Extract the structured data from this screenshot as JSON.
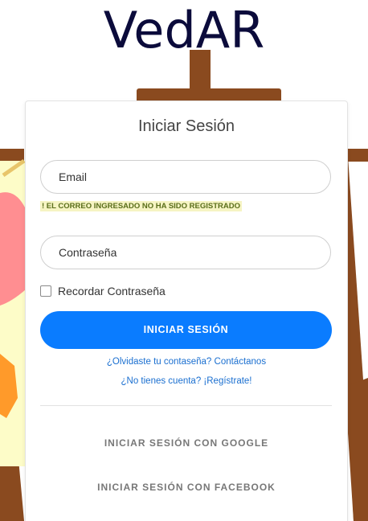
{
  "brand": {
    "title": "VedAR"
  },
  "login": {
    "title": "Iniciar Sesión",
    "email_placeholder": "Email",
    "email_error": "! EL CORREO INGRESADO NO HA SIDO REGISTRADO",
    "password_placeholder": "Contraseña",
    "remember_label": "Recordar Contraseña",
    "remember_checked": false,
    "submit_label": "INICIAR SESIÓN",
    "forgot_link": "¿Olvidaste tu contaseña? Contáctanos",
    "register_link": "¿No tienes cuenta? ¡Regístrate!",
    "google_label": "INICIAR SESIÓN CON GOOGLE",
    "facebook_label": "INICIAR SESIÓN CON FACEBOOK"
  },
  "colors": {
    "brand_title": "#0b0b3b",
    "primary_button": "#0a7cff",
    "link": "#1a6fd0",
    "error_text": "#5a6e1a",
    "error_highlight": "#f6f4c3",
    "easel_wood": "#8a4a1f"
  }
}
